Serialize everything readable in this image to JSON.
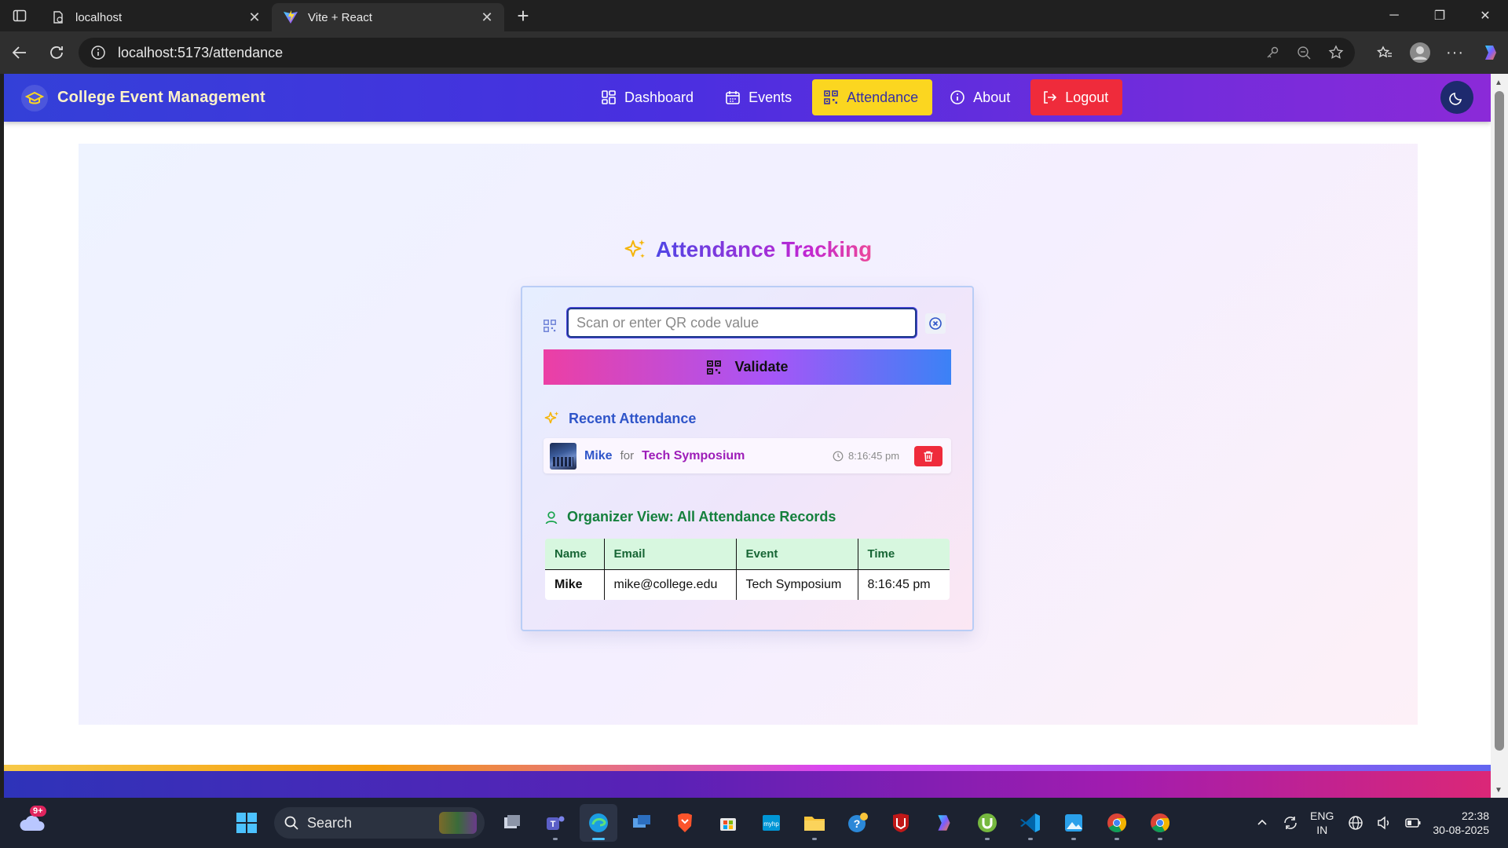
{
  "browser": {
    "tabs": [
      {
        "title": "localhost",
        "active": false
      },
      {
        "title": "Vite + React",
        "active": true
      }
    ],
    "url": "localhost:5173/attendance"
  },
  "nav": {
    "brand": "College Event Management",
    "links": [
      {
        "label": "Dashboard",
        "icon": "dashboard-icon"
      },
      {
        "label": "Events",
        "icon": "calendar-icon"
      },
      {
        "label": "Attendance",
        "icon": "qr-icon",
        "active": true
      },
      {
        "label": "About",
        "icon": "info-icon"
      },
      {
        "label": "Logout",
        "icon": "logout-icon"
      }
    ]
  },
  "page": {
    "title": "Attendance Tracking",
    "qr_placeholder": "Scan or enter QR code value",
    "validate_label": "Validate",
    "recent_title": "Recent Attendance",
    "recent": [
      {
        "name": "Mike",
        "for_label": "for",
        "event": "Tech Symposium",
        "time": "8:16:45 pm"
      }
    ],
    "organizer_title": "Organizer View: All Attendance Records",
    "table": {
      "headers": [
        "Name",
        "Email",
        "Event",
        "Time"
      ],
      "rows": [
        [
          "Mike",
          "mike@college.edu",
          "Tech Symposium",
          "8:16:45 pm"
        ]
      ]
    }
  },
  "taskbar": {
    "search_label": "Search",
    "weather_badge": "9+",
    "lang_line1": "ENG",
    "lang_line2": "IN",
    "time": "22:38",
    "date": "30-08-2025"
  },
  "colors": {
    "nav_gradient": [
      "#3340d8",
      "#8b2ad8"
    ],
    "active_link": "#fbd620",
    "logout": "#ef2b3b",
    "table_header": "#d7f7df"
  }
}
